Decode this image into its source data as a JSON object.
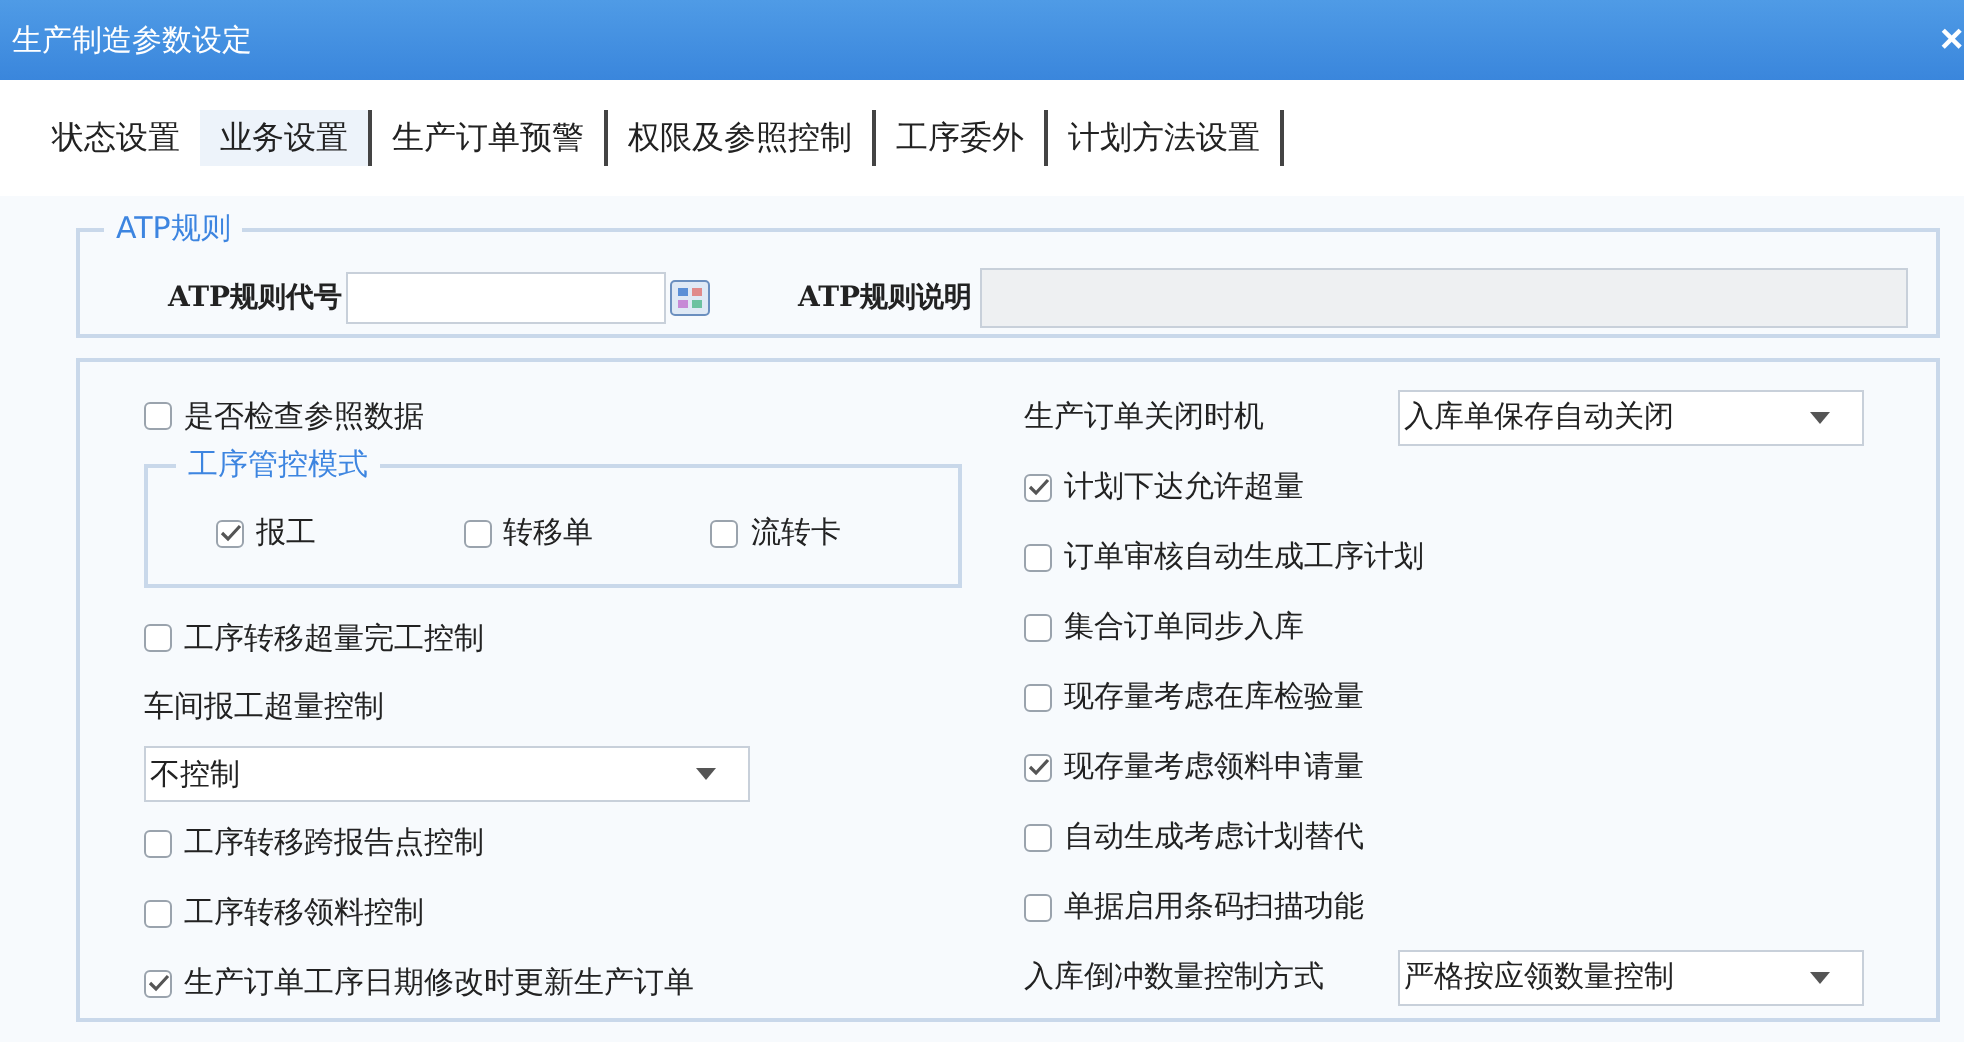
{
  "window": {
    "title": "生产制造参数设定",
    "close": "×"
  },
  "tabs": [
    {
      "label": "状态设置",
      "selected": false
    },
    {
      "label": "业务设置",
      "selected": true
    },
    {
      "label": "生产订单预警",
      "selected": false
    },
    {
      "label": "权限及参照控制",
      "selected": false
    },
    {
      "label": "工序委外",
      "selected": false
    },
    {
      "label": "计划方法设置",
      "selected": false
    }
  ],
  "atp_rule": {
    "legend": "ATP规则",
    "code_label": "ATP规则代号",
    "description_label": "ATP规则说明"
  },
  "left": [
    {
      "kind": "checkbox",
      "label": "是否检查参照数据",
      "checked": false
    },
    {
      "kind": "group",
      "legend": "工序管控模式",
      "options": [
        {
          "label": "报工",
          "checked": true
        },
        {
          "label": "转移单",
          "checked": false
        },
        {
          "label": "流转卡",
          "checked": false
        }
      ]
    },
    {
      "kind": "checkbox",
      "label": "工序转移超量完工控制",
      "checked": false
    },
    {
      "kind": "label",
      "label": "车间报工超量控制"
    },
    {
      "kind": "select",
      "value": "不控制"
    },
    {
      "kind": "checkbox",
      "label": "工序转移跨报告点控制",
      "checked": false
    },
    {
      "kind": "checkbox",
      "label": "工序转移领料控制",
      "checked": false
    },
    {
      "kind": "checkbox",
      "label": "生产订单工序日期修改时更新生产订单",
      "checked": true
    }
  ],
  "right": [
    {
      "kind": "select_row",
      "label": "生产订单关闭时机",
      "value": "入库单保存自动关闭"
    },
    {
      "kind": "checkbox",
      "label": "计划下达允许超量",
      "checked": true
    },
    {
      "kind": "checkbox",
      "label": "订单审核自动生成工序计划",
      "checked": false
    },
    {
      "kind": "checkbox",
      "label": "集合订单同步入库",
      "checked": false
    },
    {
      "kind": "checkbox",
      "label": "现存量考虑在库检验量",
      "checked": false
    },
    {
      "kind": "checkbox",
      "label": "现存量考虑领料申请量",
      "checked": true
    },
    {
      "kind": "checkbox",
      "label": "自动生成考虑计划替代",
      "checked": false
    },
    {
      "kind": "checkbox",
      "label": "单据启用条码扫描功能",
      "checked": false
    },
    {
      "kind": "select_row",
      "label": "入库倒冲数量控制方式",
      "value": "严格按应领数量控制"
    }
  ]
}
